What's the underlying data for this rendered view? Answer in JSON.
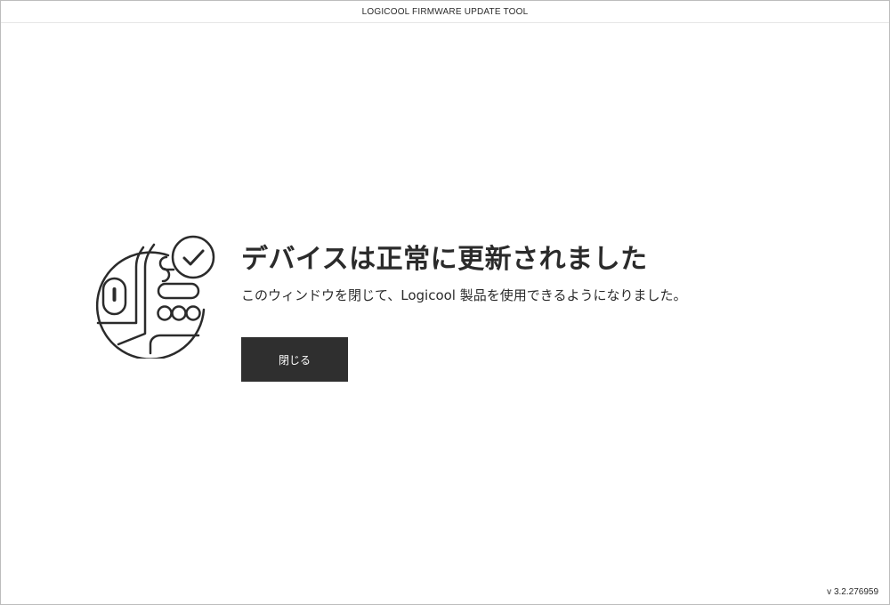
{
  "window": {
    "title": "LOGICOOL FIRMWARE UPDATE TOOL"
  },
  "illustration": {
    "icons": [
      "devices-icon",
      "mouse-icon",
      "keyboard-icon",
      "checkmark-icon"
    ]
  },
  "main": {
    "heading": "デバイスは正常に更新されました",
    "description": "このウィンドウを閉じて、Logicool 製品を使用できるようになりました。",
    "close_label": "閉じる"
  },
  "footer": {
    "version": "v 3.2.276959"
  },
  "colors": {
    "accent": "#2f2f2f",
    "text": "#2b2b2b",
    "background": "#ffffff"
  }
}
